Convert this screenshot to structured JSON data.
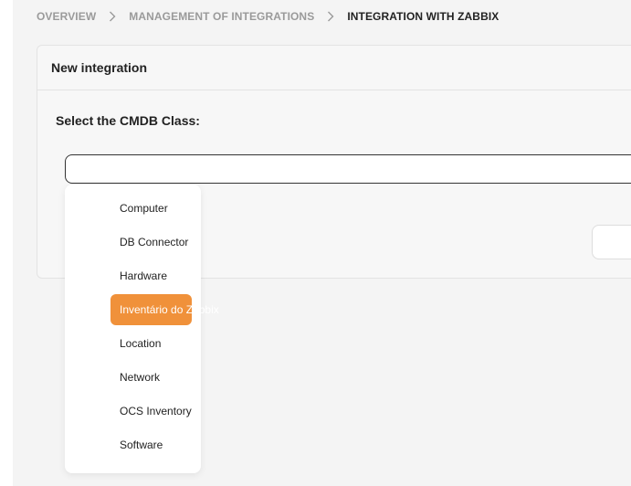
{
  "breadcrumb": {
    "items": [
      "OVERVIEW",
      "MANAGEMENT OF INTEGRATIONS",
      "INTEGRATION WITH ZABBIX"
    ],
    "separator": "›"
  },
  "panel": {
    "title": "New integration",
    "field_label": "Select the CMDB Class:",
    "input_value": ""
  },
  "dropdown": {
    "options": [
      "Computer",
      "DB Connector",
      "Hardware",
      "Inventário do Zabbix",
      "Location",
      "Network",
      "OCS Inventory",
      "Software"
    ],
    "highlighted": "Inventário do Zabbix"
  },
  "colors": {
    "accent": "#f0913a",
    "background": "#f4f4f4",
    "text": "#222222",
    "muted_text": "#9a9a9a"
  }
}
